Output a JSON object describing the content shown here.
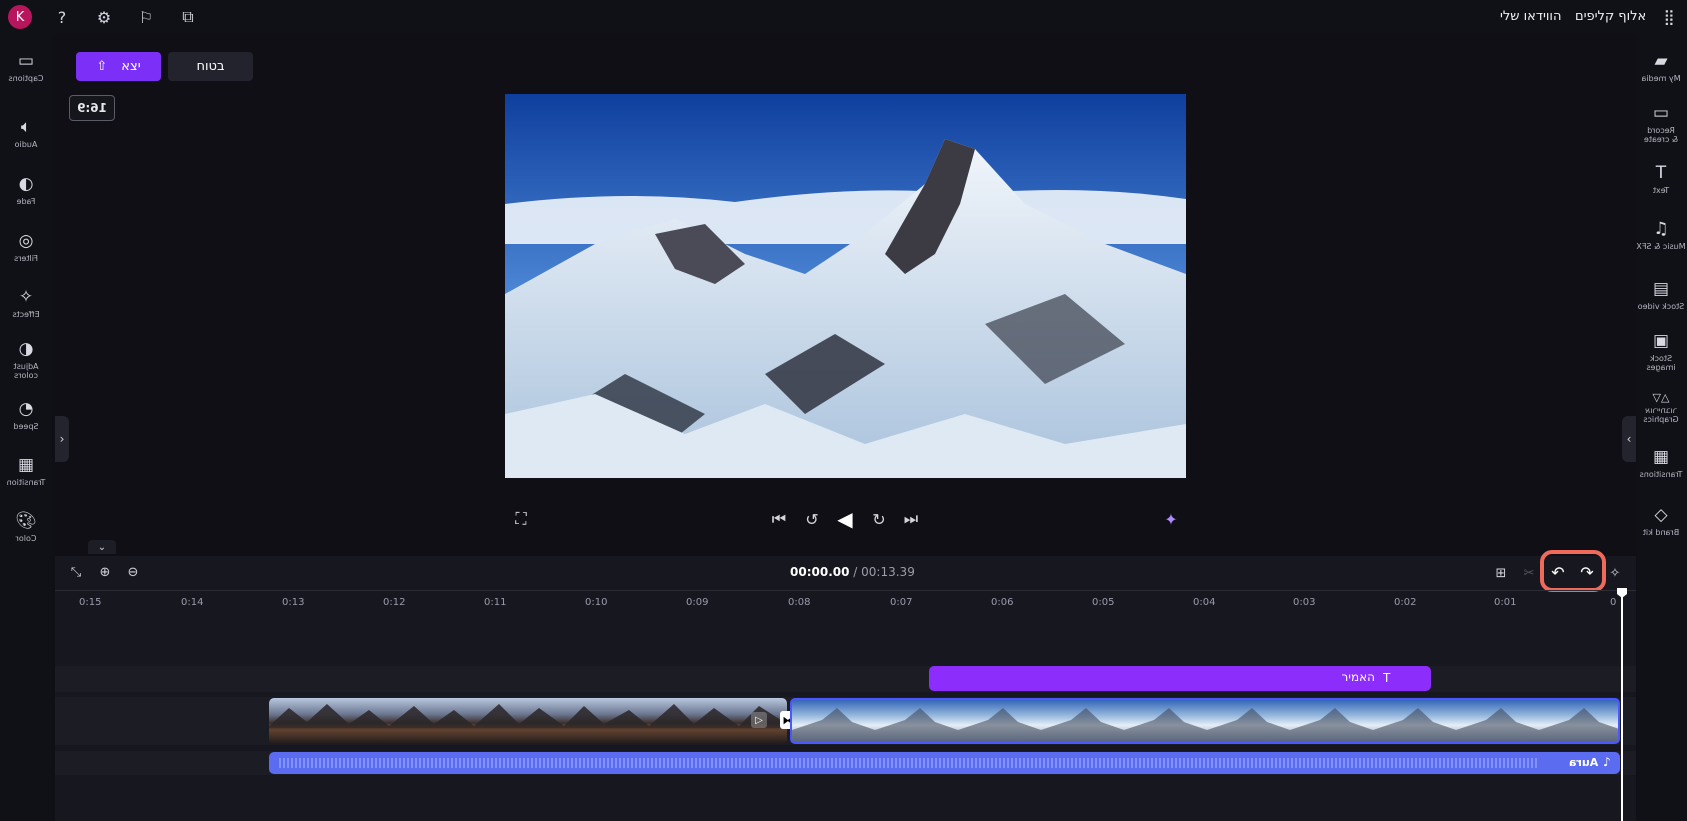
{
  "app": {
    "title": "אלוף קליפים",
    "section": "הווידאו שלי",
    "avatar_initial": "K",
    "brand_color": "#8c2dfb",
    "icons": [
      "grid-icon",
      "help-icon",
      "settings-icon",
      "feedback-icon",
      "share-icon"
    ]
  },
  "left_tools": [
    {
      "id": "captions",
      "label": "Captions",
      "icon": "captions-icon"
    },
    {
      "id": "audio",
      "label": "Audio",
      "icon": "speaker-icon"
    },
    {
      "id": "fade",
      "label": "Fade",
      "icon": "fade-icon"
    },
    {
      "id": "filters",
      "label": "Filters",
      "icon": "filters-icon"
    },
    {
      "id": "effects",
      "label": "Effects",
      "icon": "wand-icon"
    },
    {
      "id": "adjust",
      "label": "Adjust colors",
      "icon": "contrast-icon"
    },
    {
      "id": "speed",
      "label": "Speed",
      "icon": "speedometer-icon"
    },
    {
      "id": "transition",
      "label": "Transition",
      "icon": "transition-icon"
    },
    {
      "id": "color",
      "label": "Color",
      "icon": "palette-icon"
    }
  ],
  "right_tools": [
    {
      "id": "my_media",
      "label": "My media",
      "icon": "folder-icon"
    },
    {
      "id": "record",
      "label": "Record & create",
      "icon": "camera-icon"
    },
    {
      "id": "text",
      "label": "Text",
      "icon": "text-icon"
    },
    {
      "id": "music",
      "label": "Music & SFX",
      "icon": "music-icon"
    },
    {
      "id": "stock_video",
      "label": "Stock video",
      "icon": "film-icon"
    },
    {
      "id": "stock_images",
      "label": "Stock images",
      "icon": "image-icon"
    },
    {
      "id": "graphics",
      "label": "אורייתבור Graphics",
      "icon": "shapes-icon"
    },
    {
      "id": "transitions",
      "label": "Transitions",
      "icon": "transition-icon"
    },
    {
      "id": "brand_kit",
      "label": "Brand kit",
      "icon": "brand-icon"
    }
  ],
  "stage": {
    "export_label": "יצא",
    "save_label": "בטוח",
    "aspect_ratio": "16:9"
  },
  "timeline": {
    "current_time": "00:00.00",
    "total_time": "00:13.39",
    "ruler": [
      "0",
      "0:01",
      "0:02",
      "0:03",
      "0:04",
      "0:05",
      "0:06",
      "0:07",
      "0:08",
      "0:09",
      "0:10",
      "0:11",
      "0:12",
      "0:13",
      "0:14",
      "0:15"
    ],
    "text_clip_label": "האמיר",
    "audio_clip_label": "Aura",
    "highlight_color": "#f06a5b"
  }
}
